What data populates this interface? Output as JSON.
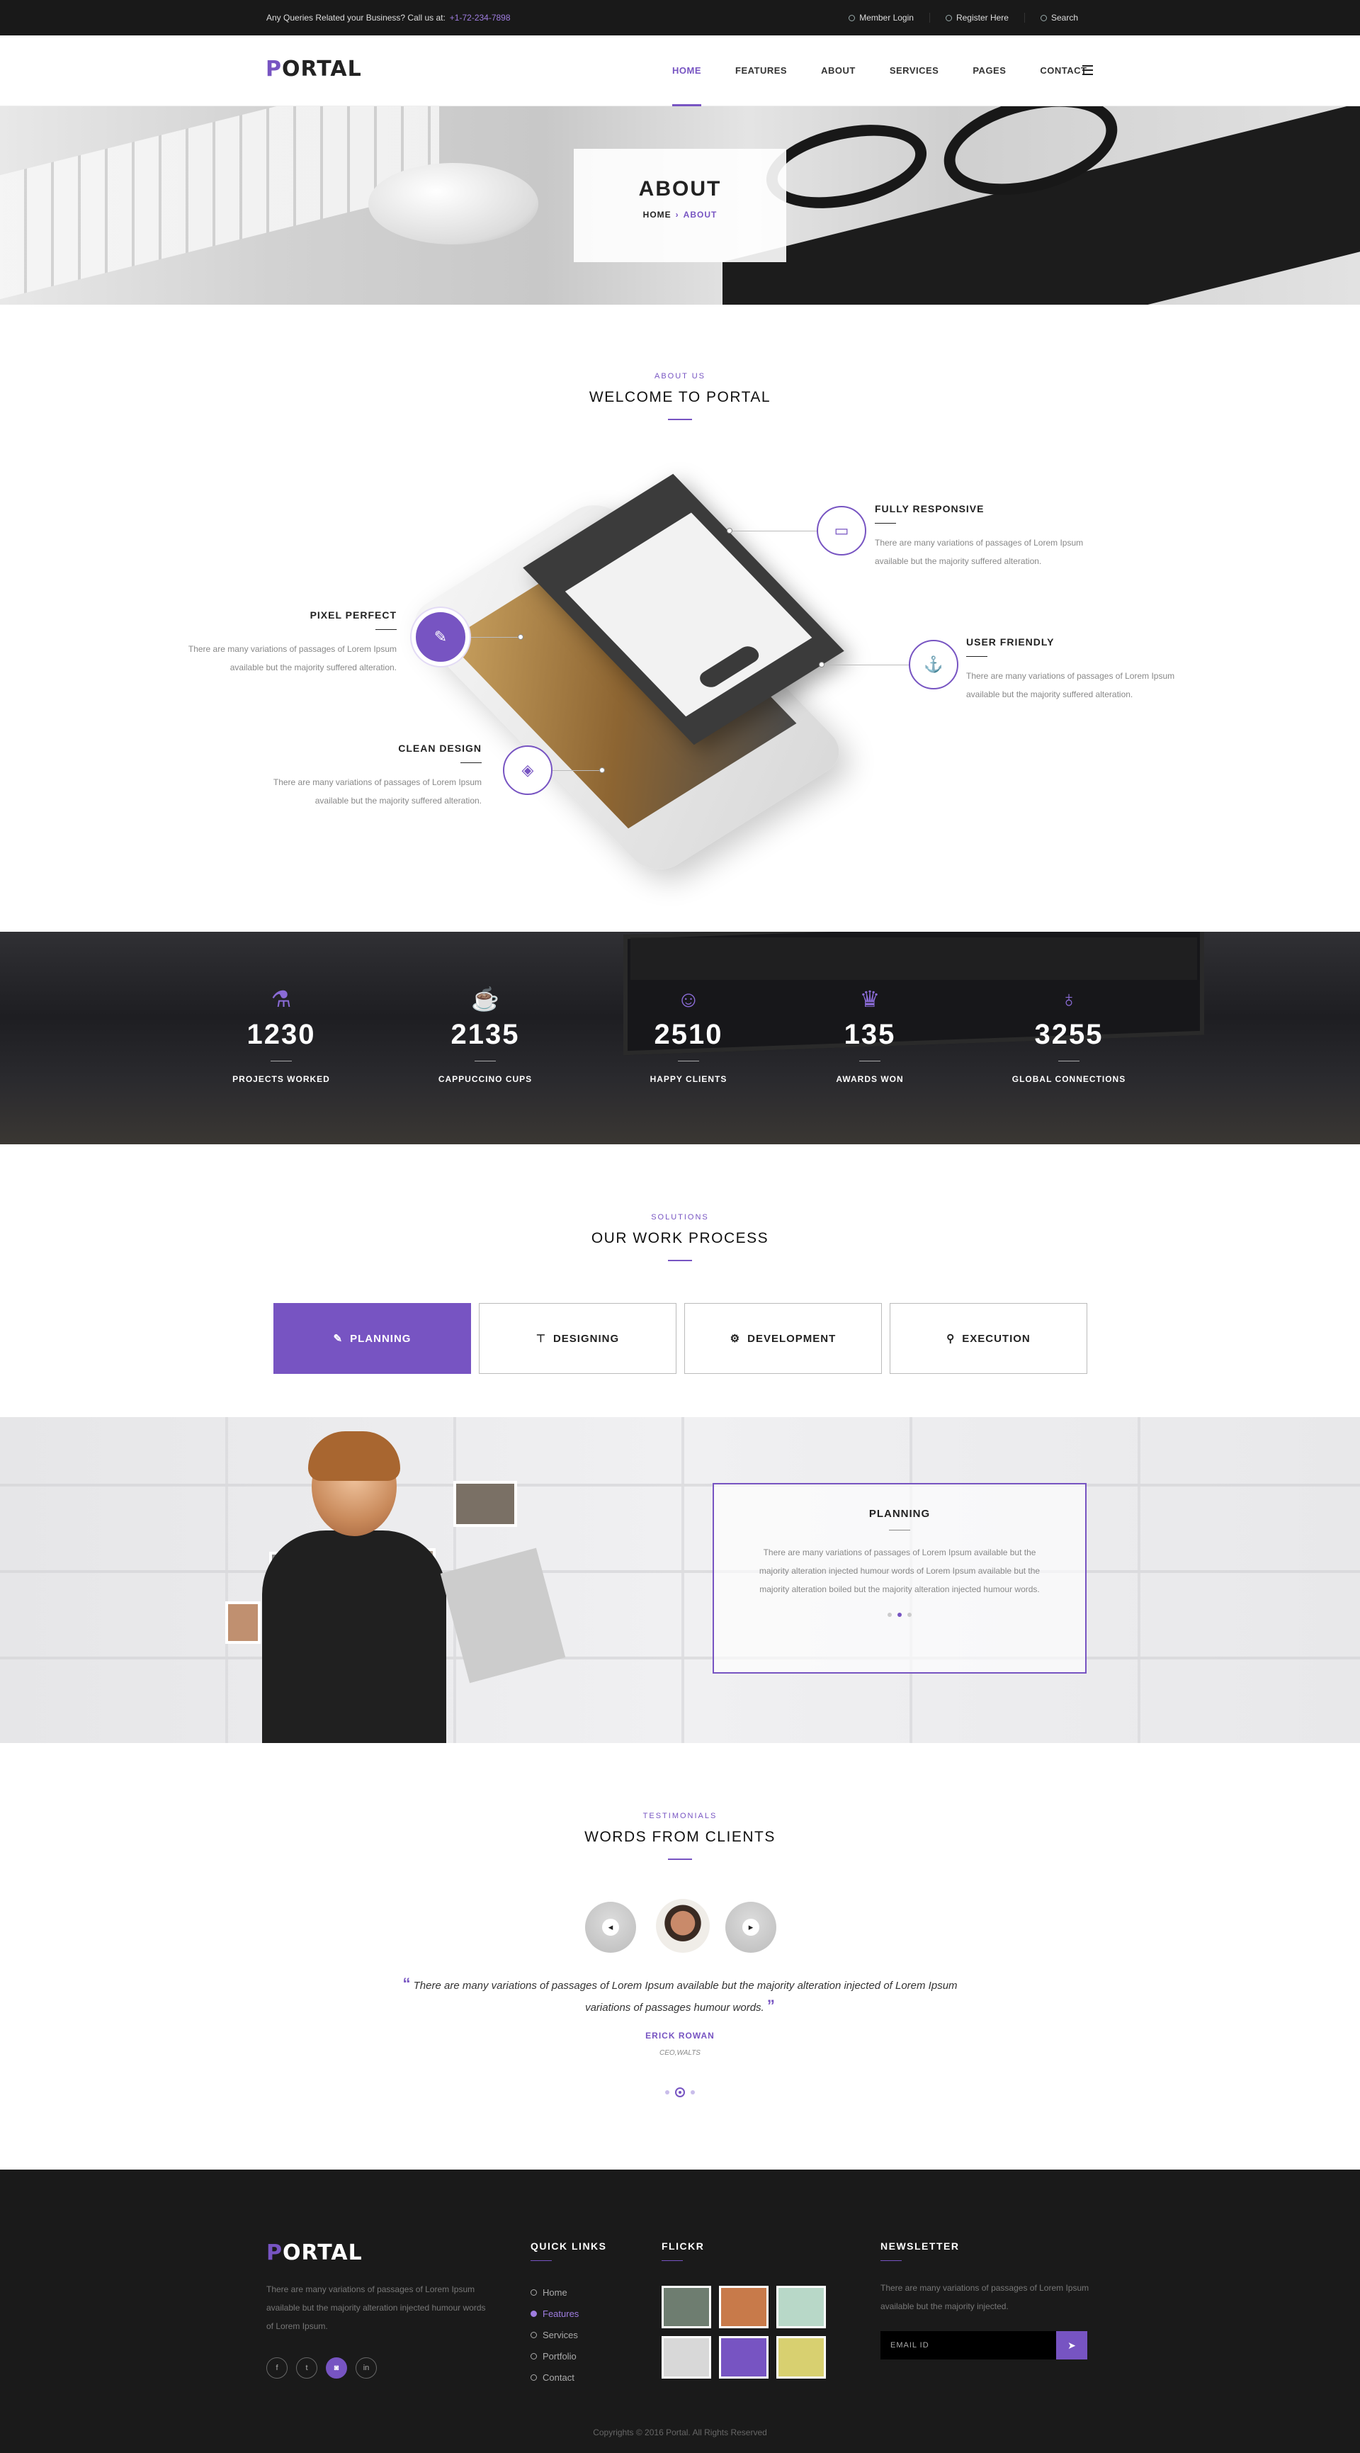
{
  "topbar": {
    "query_text": "Any Queries Related your Business? Call us at:",
    "phone": "+1-72-234-7898",
    "links": [
      "Member Login",
      "Register Here",
      "Search"
    ]
  },
  "header": {
    "logo": "PORTAL",
    "nav": [
      "HOME",
      "FEATURES",
      "ABOUT",
      "SERVICES",
      "PAGES",
      "CONTACT"
    ],
    "active_nav": "HOME"
  },
  "hero": {
    "title": "ABOUT",
    "breadcrumb_home": "HOME",
    "breadcrumb_sep": "›",
    "breadcrumb_current": "ABOUT"
  },
  "about": {
    "kicker": "ABOUT US",
    "title": "WELCOME TO PORTAL",
    "features": [
      {
        "title": "FULLY RESPONSIVE",
        "text": "There are many variations of passages of Lorem Ipsum available but the majority suffered alteration.",
        "icon": "laptop-icon"
      },
      {
        "title": "PIXEL PERFECT",
        "text": "There are many variations of passages of Lorem Ipsum available but the majority suffered alteration.",
        "icon": "pencil-icon"
      },
      {
        "title": "USER FRIENDLY",
        "text": "There are many variations of passages of Lorem Ipsum available but the majority suffered alteration.",
        "icon": "anchor-icon"
      },
      {
        "title": "CLEAN DESIGN",
        "text": "There are many variations of passages of Lorem Ipsum available but the majority suffered alteration.",
        "icon": "layers-icon"
      }
    ]
  },
  "stats": [
    {
      "value": "1230",
      "label": "PROJECTS WORKED",
      "icon": "flask-icon"
    },
    {
      "value": "2135",
      "label": "CAPPUCCINO CUPS",
      "icon": "cup-icon"
    },
    {
      "value": "2510",
      "label": "HAPPY CLIENTS",
      "icon": "users-icon"
    },
    {
      "value": "135",
      "label": "AWARDS WON",
      "icon": "crown-icon"
    },
    {
      "value": "3255",
      "label": "GLOBAL CONNECTIONS",
      "icon": "planet-icon"
    }
  ],
  "process": {
    "kicker": "SOLUTIONS",
    "title": "OUR WORK PROCESS",
    "tabs": [
      {
        "label": "PLANNING",
        "icon": "pencil-icon"
      },
      {
        "label": "DESIGNING",
        "icon": "pen-tool-icon"
      },
      {
        "label": "DEVELOPMENT",
        "icon": "gear-icon"
      },
      {
        "label": "EXECUTION",
        "icon": "pin-icon"
      }
    ],
    "active_tab": "PLANNING",
    "panel_title": "PLANNING",
    "panel_text": "There are many variations of passages of Lorem Ipsum available but the majority alteration injected humour words of Lorem Ipsum available but the majority alteration boiled but the majority alteration injected humour words."
  },
  "testimonials": {
    "kicker": "TESTIMONIALS",
    "title": "WORDS FROM CLIENTS",
    "quote": "There are many variations of passages of Lorem Ipsum available but the majority alteration injected of Lorem Ipsum variations of passages humour words.",
    "name": "ERICK ROWAN",
    "role": "CEO,WALTS"
  },
  "footer": {
    "logo": "PORTAL",
    "about_text": "There are many variations of passages of Lorem Ipsum available but the majority alteration injected humour words of Lorem Ipsum.",
    "quick_links_title": "QUICK LINKS",
    "quick_links": [
      "Home",
      "Features",
      "Services",
      "Portfolio",
      "Contact"
    ],
    "active_link": "Features",
    "flickr_title": "FLICKR",
    "newsletter_title": "NEWSLETTER",
    "newsletter_text": "There are many variations of passages of Lorem Ipsum available but the majority injected.",
    "email_placeholder": "EMAIL ID",
    "copyright": "Copyrights © 2016 Portal. All Rights Reserved",
    "social": [
      "f",
      "t",
      "◙",
      "in"
    ]
  },
  "colors": {
    "accent": "#7754c2",
    "topbar": "#191919",
    "footer": "#1a1a1a"
  }
}
